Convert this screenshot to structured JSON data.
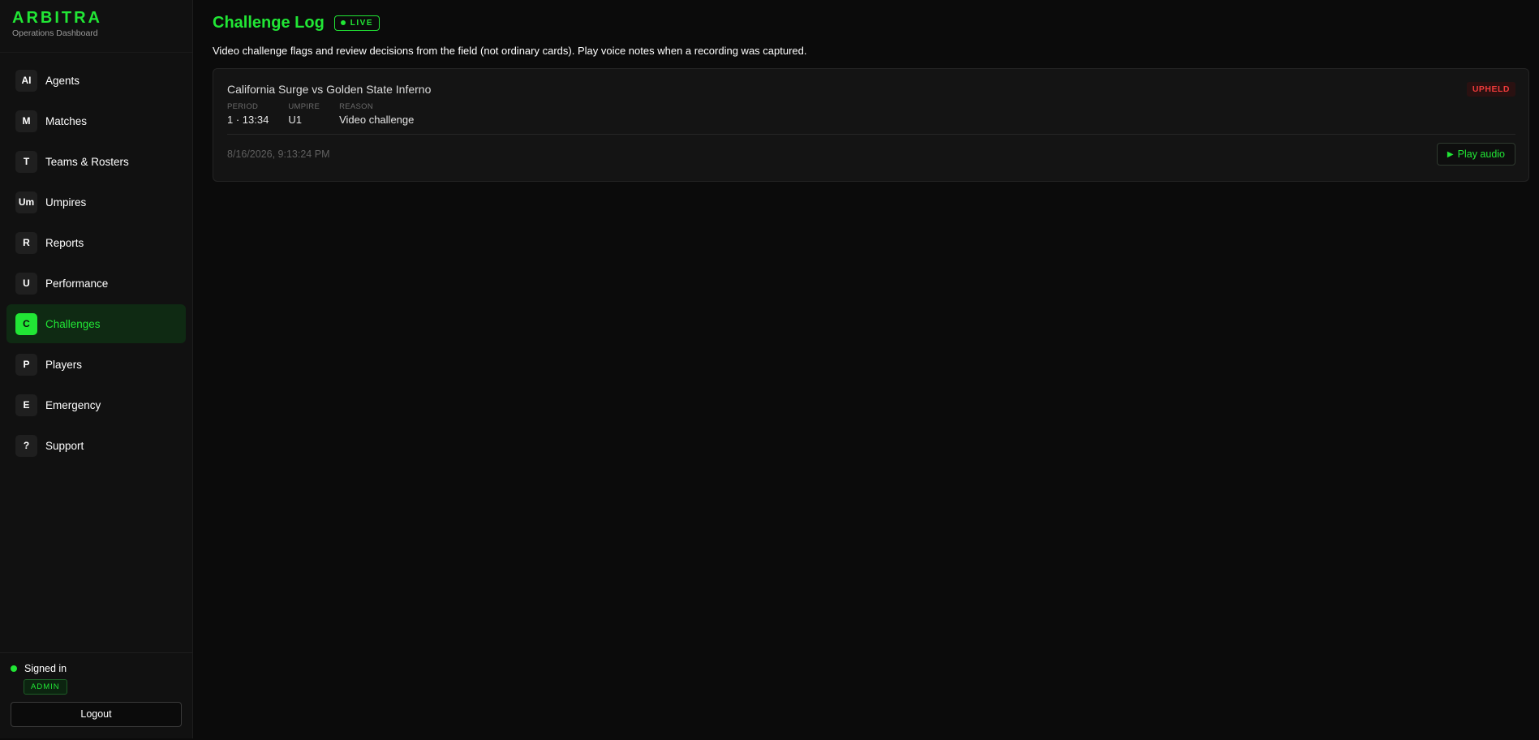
{
  "brand": {
    "title": "ARBITRA",
    "subtitle": "Operations Dashboard",
    "accent_color": "#21e635"
  },
  "sidebar": {
    "items": [
      {
        "icon": "AI",
        "label": "Agents",
        "active": false
      },
      {
        "icon": "M",
        "label": "Matches",
        "active": false
      },
      {
        "icon": "T",
        "label": "Teams & Rosters",
        "active": false
      },
      {
        "icon": "Um",
        "label": "Umpires",
        "active": false
      },
      {
        "icon": "R",
        "label": "Reports",
        "active": false
      },
      {
        "icon": "U",
        "label": "Performance",
        "active": false
      },
      {
        "icon": "C",
        "label": "Challenges",
        "active": true
      },
      {
        "icon": "P",
        "label": "Players",
        "active": false
      },
      {
        "icon": "E",
        "label": "Emergency",
        "active": false
      },
      {
        "icon": "?",
        "label": "Support",
        "active": false
      }
    ],
    "footer": {
      "status": "Signed in",
      "role": "ADMIN",
      "logout_label": "Logout"
    }
  },
  "main": {
    "title": "Challenge Log",
    "live_label": "LIVE",
    "subtitle": "Video challenge flags and review decisions from the field (not ordinary cards). Play voice notes when a recording was captured.",
    "challenges": [
      {
        "match": "California Surge vs Golden State Inferno",
        "status": "UPHELD",
        "status_color": "#ef3b3b",
        "fields": [
          {
            "label": "PERIOD",
            "value": "1 · 13:34"
          },
          {
            "label": "UMPIRE",
            "value": "U1"
          },
          {
            "label": "REASON",
            "value": "Video challenge"
          }
        ],
        "timestamp": "8/16/2026, 9:13:24 PM",
        "audio_label": "Play audio",
        "audio_icon": "play-icon"
      }
    ]
  }
}
